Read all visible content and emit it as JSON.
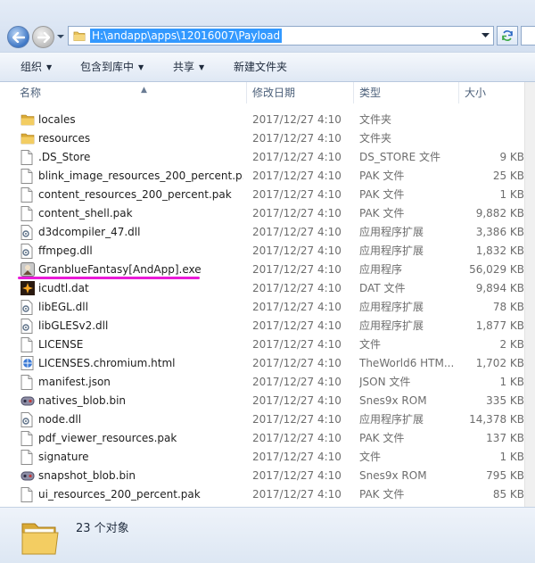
{
  "address": {
    "path": "H:\\andapp\\apps\\12016007\\Payload"
  },
  "toolbar": {
    "organize": "组织",
    "include_library": "包含到库中",
    "share": "共享",
    "new_folder": "新建文件夹"
  },
  "columns": {
    "name": "名称",
    "modified": "修改日期",
    "type": "类型",
    "size": "大小"
  },
  "files": [
    {
      "name": "locales",
      "date": "2017/12/27 4:10",
      "type": "文件夹",
      "size": "",
      "icon": "folder-icon"
    },
    {
      "name": "resources",
      "date": "2017/12/27 4:10",
      "type": "文件夹",
      "size": "",
      "icon": "folder-icon"
    },
    {
      "name": ".DS_Store",
      "date": "2017/12/27 4:10",
      "type": "DS_STORE 文件",
      "size": "9 KB",
      "icon": "file-icon"
    },
    {
      "name": "blink_image_resources_200_percent.p...",
      "date": "2017/12/27 4:10",
      "type": "PAK 文件",
      "size": "25 KB",
      "icon": "file-icon"
    },
    {
      "name": "content_resources_200_percent.pak",
      "date": "2017/12/27 4:10",
      "type": "PAK 文件",
      "size": "1 KB",
      "icon": "file-icon"
    },
    {
      "name": "content_shell.pak",
      "date": "2017/12/27 4:10",
      "type": "PAK 文件",
      "size": "9,882 KB",
      "icon": "file-icon"
    },
    {
      "name": "d3dcompiler_47.dll",
      "date": "2017/12/27 4:10",
      "type": "应用程序扩展",
      "size": "3,386 KB",
      "icon": "dll-icon"
    },
    {
      "name": "ffmpeg.dll",
      "date": "2017/12/27 4:10",
      "type": "应用程序扩展",
      "size": "1,832 KB",
      "icon": "dll-icon"
    },
    {
      "name": "GranblueFantasy[AndApp].exe",
      "date": "2017/12/27 4:10",
      "type": "应用程序",
      "size": "56,029 KB",
      "icon": "exe-icon"
    },
    {
      "name": "icudtl.dat",
      "date": "2017/12/27 4:10",
      "type": "DAT 文件",
      "size": "9,894 KB",
      "icon": "dat-icon"
    },
    {
      "name": "libEGL.dll",
      "date": "2017/12/27 4:10",
      "type": "应用程序扩展",
      "size": "78 KB",
      "icon": "dll-icon"
    },
    {
      "name": "libGLESv2.dll",
      "date": "2017/12/27 4:10",
      "type": "应用程序扩展",
      "size": "1,877 KB",
      "icon": "dll-icon"
    },
    {
      "name": "LICENSE",
      "date": "2017/12/27 4:10",
      "type": "文件",
      "size": "2 KB",
      "icon": "file-icon"
    },
    {
      "name": "LICENSES.chromium.html",
      "date": "2017/12/27 4:10",
      "type": "TheWorld6 HTM...",
      "size": "1,702 KB",
      "icon": "html-icon"
    },
    {
      "name": "manifest.json",
      "date": "2017/12/27 4:10",
      "type": "JSON 文件",
      "size": "1 KB",
      "icon": "file-icon"
    },
    {
      "name": "natives_blob.bin",
      "date": "2017/12/27 4:10",
      "type": "Snes9x ROM",
      "size": "335 KB",
      "icon": "rom-icon"
    },
    {
      "name": "node.dll",
      "date": "2017/12/27 4:10",
      "type": "应用程序扩展",
      "size": "14,378 KB",
      "icon": "dll-icon"
    },
    {
      "name": "pdf_viewer_resources.pak",
      "date": "2017/12/27 4:10",
      "type": "PAK 文件",
      "size": "137 KB",
      "icon": "file-icon"
    },
    {
      "name": "signature",
      "date": "2017/12/27 4:10",
      "type": "文件",
      "size": "1 KB",
      "icon": "file-icon"
    },
    {
      "name": "snapshot_blob.bin",
      "date": "2017/12/27 4:10",
      "type": "Snes9x ROM",
      "size": "795 KB",
      "icon": "rom-icon"
    },
    {
      "name": "ui_resources_200_percent.pak",
      "date": "2017/12/27 4:10",
      "type": "PAK 文件",
      "size": "85 KB",
      "icon": "file-icon"
    }
  ],
  "highlight_color": "#e91bd8",
  "status": {
    "count": "23 个对象"
  }
}
